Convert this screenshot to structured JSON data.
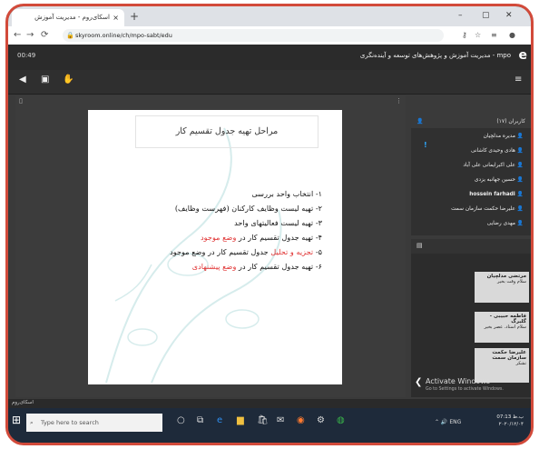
{
  "browser": {
    "tab_title": "اسکای‌روم - مدیریت آموزش",
    "close_glyph": "×",
    "newtab_glyph": "+",
    "url": "skyroom.online/ch/mpo-sabt/edu",
    "win_min": "–",
    "win_max": "▢",
    "win_close": "✕"
  },
  "app": {
    "time": "00:49",
    "title": "mpo - مدیریت آموزش و پژوهش‌های توسعه و آینده‌نگری",
    "logo": "e"
  },
  "slide": {
    "title": "مراحل تهیه جدول تقسیم کار",
    "items": [
      {
        "pre": "۱- انتخاب واحد بررسی",
        "red": "",
        "post": ""
      },
      {
        "pre": "۲- تهیه لیست وظایف کارکنان (فهرست وظایف)",
        "red": "",
        "post": ""
      },
      {
        "pre": "۳- تهیه لیست فعالیتهای واحد",
        "red": "",
        "post": ""
      },
      {
        "pre": "۴- تهیه جدول تقسیم کار در ",
        "red": "وضع موجود",
        "post": ""
      },
      {
        "pre": "۵- ",
        "red": "تجزیه و تحلیل",
        "post": " جدول تقسیم کار در وضع موجود"
      },
      {
        "pre": "۶- تهیه جدول تقسیم کار در ",
        "red": "وضع پیشنهادی",
        "post": ""
      }
    ]
  },
  "attendees": {
    "header": "کاربران (۱۷)",
    "list": [
      "مدیره مدلچیان",
      "هادی وحیدی کاشانی",
      "علی اکبرایمانی علی آباد",
      "حسین جهانبه یزدی",
      "hossein farhadi",
      "علیرضا حکمت سازمان سمت",
      "مهدی رضایی"
    ]
  },
  "chat": {
    "messages": [
      {
        "name": "مرتضی مدلچیان",
        "text": "سلام وقت بخیر"
      },
      {
        "name": "فاطمه حبیبی - گلبرگ",
        "text": "سلام استاد. عصر بخیر"
      },
      {
        "name": "علیرضا حکمت سازمان سمت",
        "text": "تشکر"
      }
    ]
  },
  "watermark": {
    "line1": "Activate Windows",
    "line2": "Go to Settings to activate Windows."
  },
  "statusbar": "اسکای‌روم",
  "taskbar": {
    "search_placeholder": "Type here to search",
    "time": "07:13 ب.ظ",
    "date": "۲۰۲۰/۱۲/۰۴"
  }
}
